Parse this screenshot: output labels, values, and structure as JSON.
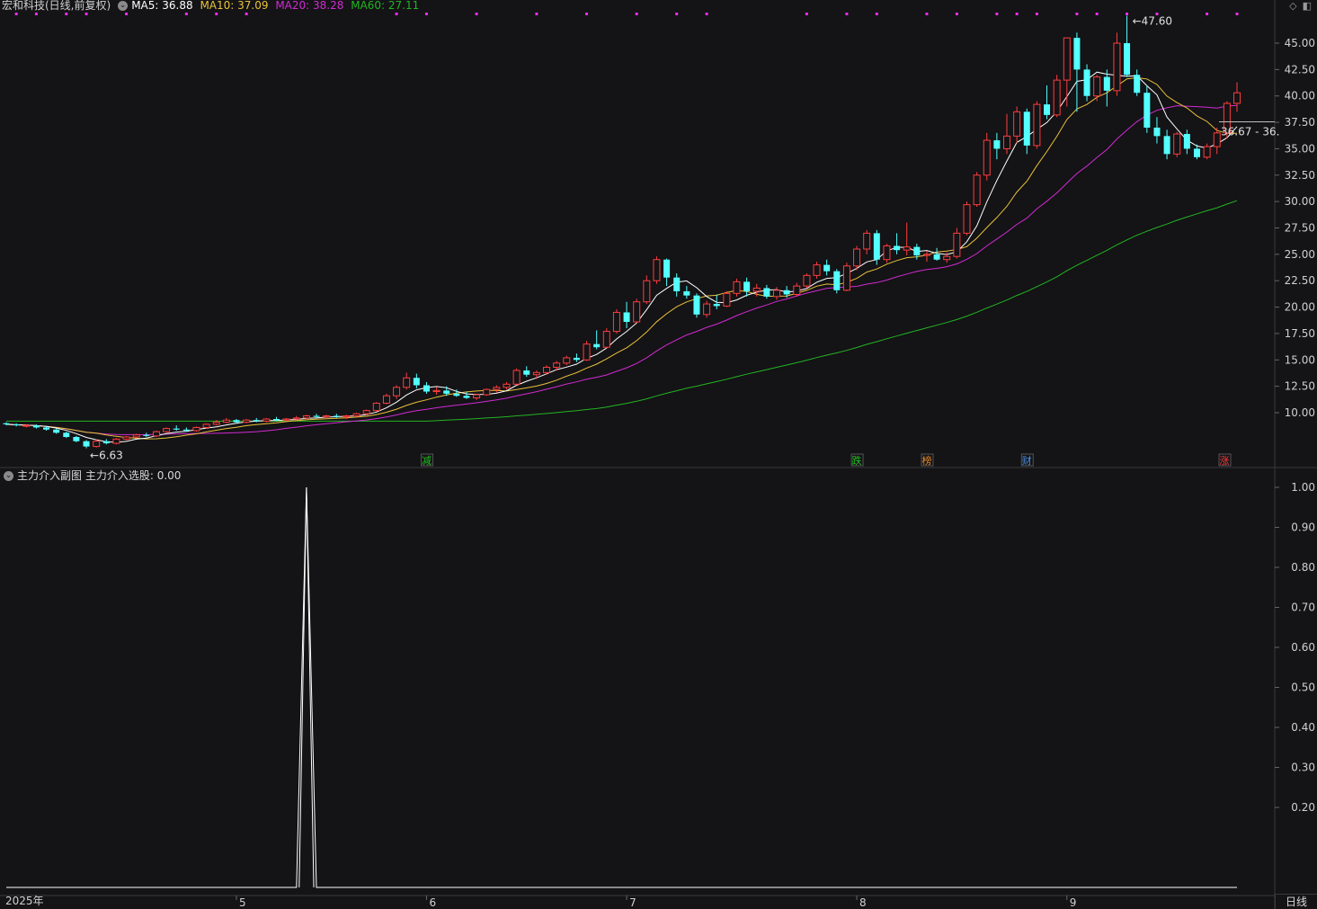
{
  "header": {
    "stock_name": "宏和科技(日线,前复权)",
    "ma5": "MA5: 36.88",
    "ma10": "MA10: 37.09",
    "ma20": "MA20: 38.28",
    "ma60": "MA60: 27.11"
  },
  "colors": {
    "background": "#141316",
    "up": "#ff3d3d",
    "down": "#54ffff",
    "ma5": "#ffffff",
    "ma10": "#e8c23a",
    "ma20": "#d12bd1",
    "ma60": "#22b522",
    "signal_dots": "#e630e6"
  },
  "price_axis": {
    "labels": [
      "45.00",
      "42.50",
      "40.00",
      "37.50",
      "35.00",
      "32.50",
      "30.00",
      "27.50",
      "25.00",
      "22.50",
      "20.00",
      "17.50",
      "15.00",
      "12.50",
      "10.00"
    ],
    "range": [
      7.5,
      47.8
    ]
  },
  "annotations": {
    "high": "47.60",
    "low": "6.63",
    "current_range": "36.67 - 36."
  },
  "event_tags": [
    {
      "label": "减",
      "color": "#22c222"
    },
    {
      "label": "跌",
      "color": "#22c222"
    },
    {
      "label": "榜",
      "color": "#e88a2a"
    },
    {
      "label": "财",
      "color": "#4a90e8"
    },
    {
      "label": "涨",
      "color": "#ff3d3d"
    }
  ],
  "sub_chart": {
    "title": "主力介入副图",
    "value_label": "主力介入选股: 0.00",
    "axis_labels": [
      "1.00",
      "0.90",
      "0.80",
      "0.70",
      "0.60",
      "0.50",
      "0.40",
      "0.30",
      "0.20"
    ],
    "range": [
      0,
      1
    ]
  },
  "time_axis": {
    "year_label": "2025年",
    "month_labels": [
      "5",
      "6",
      "7",
      "8",
      "9"
    ]
  },
  "period_button": "日线",
  "chart_data": {
    "type": "candlestick",
    "series": [
      {
        "name": "K",
        "values": [
          [
            9.0,
            9.1,
            8.8,
            8.9
          ],
          [
            8.9,
            9.0,
            8.7,
            8.8
          ],
          [
            8.8,
            8.9,
            8.6,
            8.8
          ],
          [
            8.8,
            8.9,
            8.5,
            8.6
          ],
          [
            8.6,
            8.7,
            8.3,
            8.4
          ],
          [
            8.4,
            8.5,
            8.0,
            8.1
          ],
          [
            8.1,
            8.2,
            7.6,
            7.7
          ],
          [
            7.7,
            7.8,
            7.2,
            7.3
          ],
          [
            7.3,
            7.4,
            6.63,
            6.8
          ],
          [
            6.8,
            7.5,
            6.7,
            7.3
          ],
          [
            7.3,
            7.5,
            7.0,
            7.1
          ],
          [
            7.1,
            7.6,
            7.0,
            7.5
          ],
          [
            7.5,
            7.8,
            7.4,
            7.7
          ],
          [
            7.7,
            8.0,
            7.6,
            7.9
          ],
          [
            7.9,
            8.1,
            7.7,
            7.8
          ],
          [
            7.8,
            8.3,
            7.7,
            8.2
          ],
          [
            8.2,
            8.6,
            8.1,
            8.5
          ],
          [
            8.5,
            8.8,
            8.3,
            8.4
          ],
          [
            8.4,
            8.6,
            8.2,
            8.3
          ],
          [
            8.3,
            8.7,
            8.2,
            8.6
          ],
          [
            8.6,
            9.0,
            8.5,
            8.9
          ],
          [
            8.9,
            9.3,
            8.8,
            9.1
          ],
          [
            9.1,
            9.5,
            9.0,
            9.3
          ],
          [
            9.3,
            9.4,
            9.0,
            9.1
          ],
          [
            9.1,
            9.4,
            9.0,
            9.3
          ],
          [
            9.3,
            9.5,
            9.1,
            9.2
          ],
          [
            9.2,
            9.5,
            9.1,
            9.4
          ],
          [
            9.4,
            9.6,
            9.2,
            9.3
          ],
          [
            9.3,
            9.5,
            9.2,
            9.4
          ],
          [
            9.4,
            9.7,
            9.3,
            9.5
          ],
          [
            9.5,
            9.8,
            9.4,
            9.7
          ],
          [
            9.7,
            9.9,
            9.5,
            9.6
          ],
          [
            9.6,
            9.8,
            9.5,
            9.7
          ],
          [
            9.7,
            9.9,
            9.5,
            9.6
          ],
          [
            9.6,
            9.8,
            9.4,
            9.7
          ],
          [
            9.7,
            10.0,
            9.6,
            9.9
          ],
          [
            9.9,
            10.3,
            9.8,
            10.2
          ],
          [
            10.2,
            11.0,
            10.1,
            10.9
          ],
          [
            10.9,
            11.8,
            10.8,
            11.6
          ],
          [
            11.6,
            12.6,
            11.3,
            12.4
          ],
          [
            12.4,
            13.8,
            12.2,
            13.3
          ],
          [
            13.3,
            13.7,
            12.3,
            12.6
          ],
          [
            12.6,
            12.9,
            11.8,
            12.0
          ],
          [
            12.0,
            12.4,
            11.7,
            12.1
          ],
          [
            12.1,
            12.5,
            11.6,
            11.8
          ],
          [
            11.8,
            12.2,
            11.5,
            11.6
          ],
          [
            11.6,
            12.0,
            11.3,
            11.4
          ],
          [
            11.4,
            11.8,
            11.2,
            11.7
          ],
          [
            11.7,
            12.3,
            11.6,
            12.2
          ],
          [
            12.2,
            12.6,
            11.9,
            12.4
          ],
          [
            12.4,
            12.9,
            12.2,
            12.7
          ],
          [
            12.7,
            14.2,
            12.6,
            14.0
          ],
          [
            14.0,
            14.4,
            13.4,
            13.6
          ],
          [
            13.6,
            14.0,
            13.2,
            13.8
          ],
          [
            13.8,
            14.5,
            13.6,
            14.3
          ],
          [
            14.3,
            14.9,
            14.0,
            14.7
          ],
          [
            14.7,
            15.4,
            14.5,
            15.2
          ],
          [
            15.2,
            15.6,
            14.8,
            15.0
          ],
          [
            15.0,
            16.8,
            14.9,
            16.5
          ],
          [
            16.5,
            17.8,
            16.0,
            16.2
          ],
          [
            16.2,
            18.0,
            16.1,
            17.7
          ],
          [
            17.7,
            19.8,
            17.5,
            19.5
          ],
          [
            19.5,
            20.5,
            18.0,
            18.6
          ],
          [
            18.6,
            20.8,
            18.5,
            20.5
          ],
          [
            20.5,
            23.0,
            20.3,
            22.5
          ],
          [
            22.5,
            24.8,
            22.2,
            24.5
          ],
          [
            24.5,
            24.6,
            22.0,
            22.8
          ],
          [
            22.8,
            23.2,
            21.0,
            21.5
          ],
          [
            21.5,
            22.0,
            20.8,
            21.1
          ],
          [
            21.1,
            21.3,
            19.0,
            19.3
          ],
          [
            19.3,
            20.6,
            19.0,
            20.3
          ],
          [
            20.3,
            21.2,
            19.8,
            20.1
          ],
          [
            20.1,
            21.5,
            20.0,
            21.3
          ],
          [
            21.3,
            22.7,
            21.0,
            22.4
          ],
          [
            22.4,
            22.8,
            21.0,
            21.5
          ],
          [
            21.5,
            22.2,
            21.0,
            21.8
          ],
          [
            21.8,
            22.1,
            20.8,
            21.0
          ],
          [
            21.0,
            21.9,
            20.7,
            21.6
          ],
          [
            21.6,
            22.0,
            20.9,
            21.2
          ],
          [
            21.2,
            22.3,
            21.0,
            22.0
          ],
          [
            22.0,
            23.2,
            21.8,
            23.0
          ],
          [
            23.0,
            24.3,
            22.7,
            24.0
          ],
          [
            24.0,
            24.5,
            23.0,
            23.4
          ],
          [
            23.4,
            23.6,
            21.3,
            21.6
          ],
          [
            21.6,
            24.2,
            21.5,
            23.9
          ],
          [
            23.9,
            25.8,
            23.5,
            25.5
          ],
          [
            25.5,
            27.3,
            25.0,
            27.0
          ],
          [
            27.0,
            27.3,
            24.0,
            24.5
          ],
          [
            24.5,
            26.0,
            24.2,
            25.8
          ],
          [
            25.8,
            27.0,
            25.0,
            25.4
          ],
          [
            25.4,
            28.0,
            24.9,
            25.7
          ],
          [
            25.7,
            26.0,
            24.5,
            24.9
          ],
          [
            24.9,
            25.3,
            24.3,
            25.0
          ],
          [
            25.0,
            25.6,
            24.4,
            24.5
          ],
          [
            24.5,
            25.2,
            24.2,
            24.8
          ],
          [
            24.8,
            27.5,
            24.6,
            27.0
          ],
          [
            27.0,
            30.0,
            26.8,
            29.7
          ],
          [
            29.7,
            32.8,
            29.5,
            32.5
          ],
          [
            32.5,
            36.5,
            32.0,
            35.8
          ],
          [
            35.8,
            36.5,
            34.0,
            35.0
          ],
          [
            35.0,
            38.3,
            34.5,
            36.2
          ],
          [
            36.2,
            39.0,
            35.5,
            38.5
          ],
          [
            38.5,
            38.8,
            34.5,
            35.3
          ],
          [
            35.3,
            39.5,
            35.0,
            39.2
          ],
          [
            39.2,
            41.0,
            37.8,
            38.2
          ],
          [
            38.2,
            42.0,
            38.0,
            41.5
          ],
          [
            41.5,
            43.5,
            39.0,
            45.5
          ],
          [
            45.5,
            46.0,
            38.5,
            42.5
          ],
          [
            42.5,
            43.0,
            39.5,
            40.0
          ],
          [
            40.0,
            42.0,
            39.5,
            41.8
          ],
          [
            41.8,
            42.5,
            39.0,
            40.5
          ],
          [
            40.5,
            46.0,
            40.0,
            45.0
          ],
          [
            45.0,
            47.6,
            41.8,
            42.0
          ],
          [
            42.0,
            42.5,
            40.0,
            40.3
          ],
          [
            40.3,
            41.0,
            36.5,
            37.0
          ],
          [
            37.0,
            38.0,
            35.5,
            36.2
          ],
          [
            36.2,
            36.8,
            34.0,
            34.5
          ],
          [
            34.5,
            36.6,
            34.2,
            36.4
          ],
          [
            36.4,
            36.8,
            34.5,
            35.0
          ],
          [
            35.0,
            35.4,
            34.0,
            34.2
          ],
          [
            34.2,
            35.5,
            34.0,
            35.2
          ],
          [
            35.2,
            37.0,
            34.5,
            36.5
          ],
          [
            36.5,
            39.5,
            36.0,
            39.3
          ],
          [
            39.3,
            41.3,
            38.5,
            40.3
          ]
        ]
      }
    ],
    "ylim": [
      7.5,
      47.8
    ]
  }
}
